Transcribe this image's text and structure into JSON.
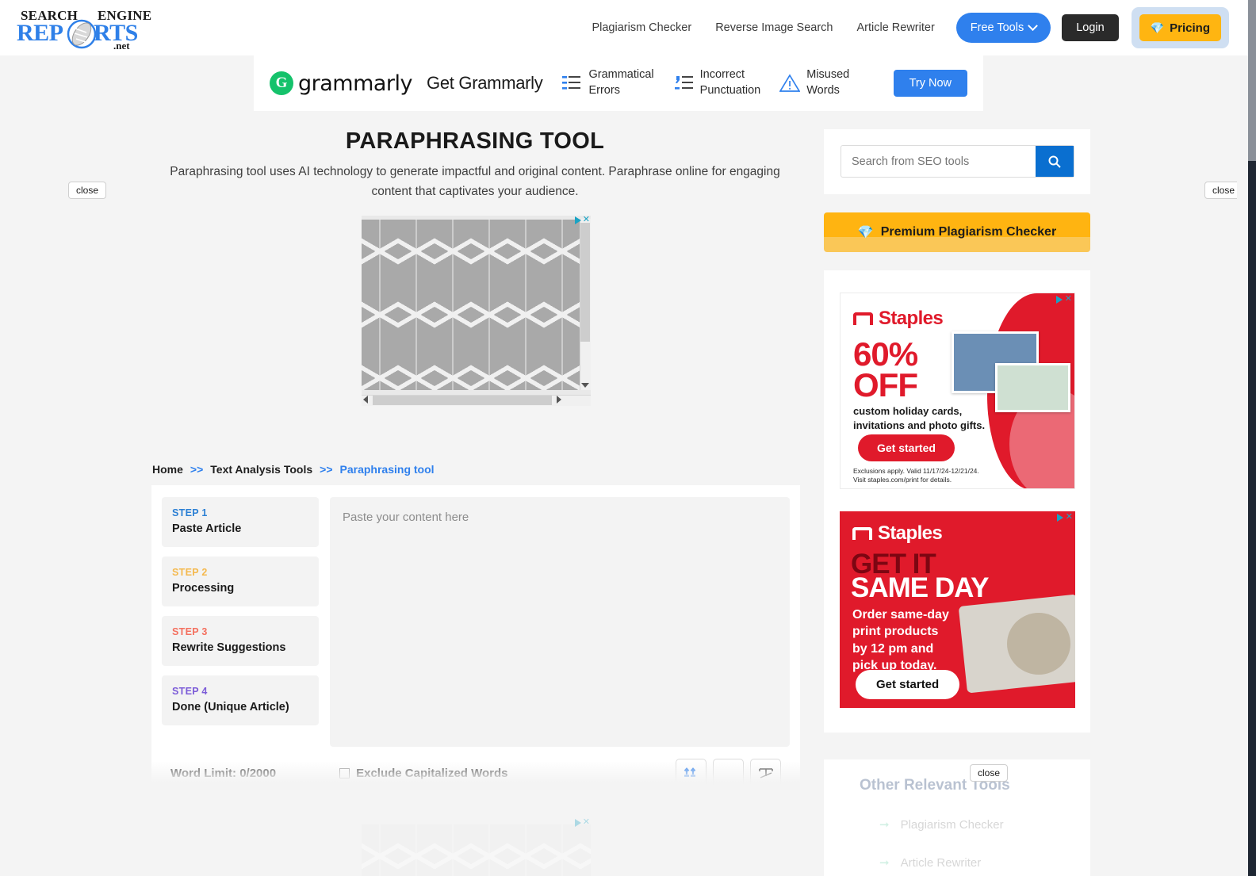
{
  "header": {
    "logo": {
      "search": "SEARCH",
      "engine": "ENGINE",
      "rep": "REP",
      "rts": "RTS",
      "net": ".net"
    },
    "nav": [
      {
        "label": "Plagiarism Checker"
      },
      {
        "label": "Reverse Image Search"
      },
      {
        "label": "Article Rewriter"
      }
    ],
    "free_tools_label": "Free Tools",
    "login_label": "Login",
    "pricing_label": "Pricing",
    "pricing_icon": "gem-icon"
  },
  "grammarly_banner": {
    "logo_letter": "G",
    "brand": "grammarly",
    "headline": "Get Grammarly",
    "features": [
      {
        "icon": "list-lines-icon",
        "line1": "Grammatical",
        "line2": "Errors"
      },
      {
        "icon": "punctuation-icon",
        "line1": "Incorrect",
        "line2": "Punctuation"
      },
      {
        "icon": "warning-triangle-icon",
        "line1": "Misused",
        "line2": "Words"
      }
    ],
    "cta_label": "Try Now"
  },
  "main": {
    "title": "PARAPHRASING TOOL",
    "subtitle": "Paraphrasing tool uses AI technology to generate impactful and original content. Paraphrase online for engaging content that captivates your audience."
  },
  "breadcrumb": {
    "home": "Home",
    "sep1": ">>",
    "middle": "Text Analysis Tools",
    "sep2": ">>",
    "current": "Paraphrasing tool"
  },
  "tool": {
    "steps": [
      {
        "key": "STEP 1",
        "title": "Paste Article",
        "color": "#2b7fd4"
      },
      {
        "key": "STEP 2",
        "title": "Processing",
        "color": "#f5b94e"
      },
      {
        "key": "STEP 3",
        "title": "Rewrite Suggestions",
        "color": "#f4705f"
      },
      {
        "key": "STEP 4",
        "title": "Done (Unique Article)",
        "color": "#7c5cd8"
      }
    ],
    "textarea_placeholder": "Paste your content here",
    "word_limit": "Word Limit: 0/2000",
    "exclude_label": "Exclude Capitalized Words",
    "buttons": [
      {
        "name": "upload-file-icon"
      },
      {
        "name": "blank-icon"
      },
      {
        "name": "text-tool-icon"
      }
    ]
  },
  "sidebar": {
    "search_placeholder": "Search from SEO tools",
    "search_icon": "search-icon",
    "premium_label": "Premium Plagiarism Checker",
    "premium_icon": "gem-icon",
    "other_tools": {
      "title": "Other Relevant Tools",
      "items": [
        {
          "label": "Plagiarism Checker"
        },
        {
          "label": "Article Rewriter"
        }
      ]
    }
  },
  "ads": {
    "adchoices_label": "AdChoices",
    "close_label": "close",
    "staples1": {
      "brand": "Staples",
      "headline1": "60%",
      "headline2": "OFF",
      "body1": "custom holiday cards,",
      "body2": "invitations and photo gifts.",
      "cta": "Get started",
      "fine1": "Exclusions apply. Valid 11/17/24-12/21/24.",
      "fine2": "Visit staples.com/print for details."
    },
    "staples2": {
      "brand": "Staples",
      "headline1": "GET IT",
      "headline2": "SAME DAY",
      "body1": "Order same-day",
      "body2": "print products",
      "body3": "by 12 pm and",
      "body4": "pick up today.",
      "cta": "Get started"
    }
  }
}
